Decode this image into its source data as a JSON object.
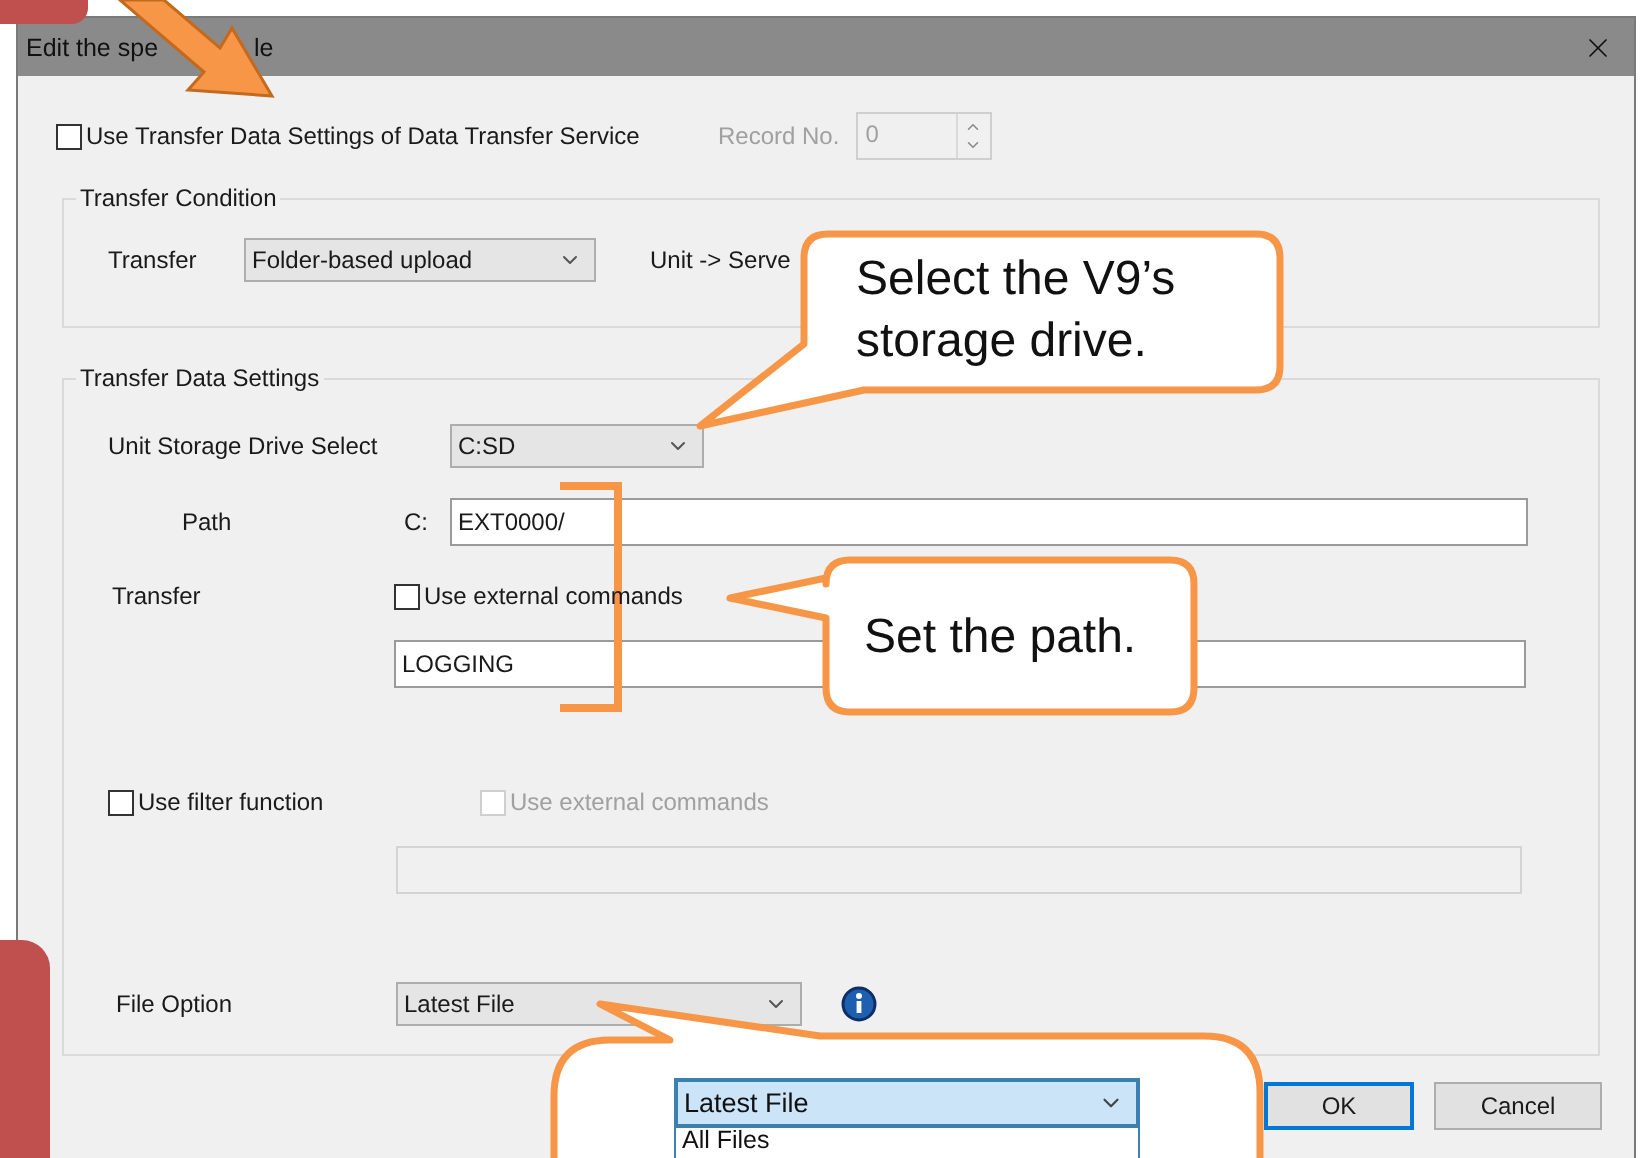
{
  "window": {
    "title_parts": [
      "Edit the spe",
      "le"
    ]
  },
  "use_transfer_settings": {
    "label": "Use Transfer Data Settings of Data Transfer Service",
    "checked": false
  },
  "record_no": {
    "label": "Record No.",
    "value": "0",
    "disabled": true
  },
  "transfer_condition": {
    "title": "Transfer Condition",
    "transfer_label": "Transfer",
    "transfer_value": "Folder-based upload",
    "direction": "Unit -> Serve"
  },
  "transfer_data_settings": {
    "title": "Transfer Data Settings",
    "drive_label": "Unit Storage Drive Select",
    "drive_value": "C:SD",
    "path_label": "Path",
    "path_prefix": "C:",
    "path_value": "EXT0000/",
    "transfer_label": "Transfer",
    "external": {
      "label": "Use external commands",
      "checked": false,
      "disabled": false
    },
    "transfer_value": "LOGGING",
    "filter": {
      "label": "Use filter function",
      "checked": false,
      "disabled": false
    },
    "filter_external": {
      "label": "Use external commands",
      "checked": false,
      "disabled": true
    },
    "filter_field": {
      "disabled": true
    },
    "file_option_label": "File Option",
    "file_option_value": "Latest File"
  },
  "buttons": [
    {
      "label": "OK",
      "focused": true
    },
    {
      "label": "Cancel",
      "focused": false
    }
  ],
  "callouts": [
    {
      "text": "Select the V9’s storage drive."
    },
    {
      "text": "Set the path."
    },
    {
      "dropdown": {
        "value": "Latest File",
        "options": [
          {
            "label": "All Files",
            "selected": false
          }
        ]
      }
    }
  ]
}
